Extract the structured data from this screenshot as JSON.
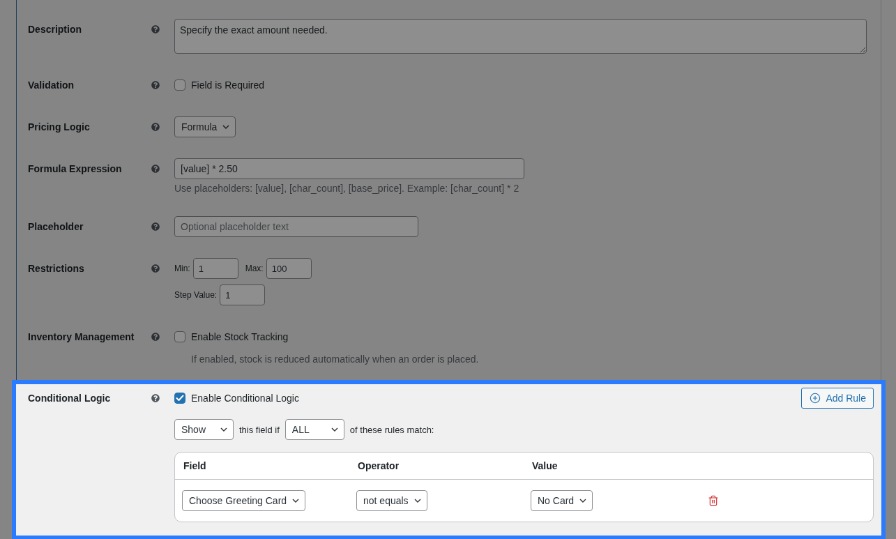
{
  "fields": [
    {
      "kind": "textarea",
      "label": "Description",
      "value": "Specify the exact amount needed.",
      "highlighted": false
    },
    {
      "kind": "checkbox",
      "label": "Validation",
      "option": "Field is Required",
      "checked": false,
      "highlighted": false
    },
    {
      "kind": "select",
      "label": "Pricing Logic",
      "value": "Formula",
      "highlighted": false
    },
    {
      "kind": "formula",
      "label": "Formula Expression",
      "value": "[value] * 2.50",
      "hint": "Use placeholders: [value], [char_count], [base_price]. Example: [char_count] * 2",
      "highlighted": false
    },
    {
      "kind": "text",
      "label": "Placeholder",
      "placeholder": "Optional placeholder text",
      "highlighted": false
    },
    {
      "kind": "restrictions",
      "label": "Restrictions",
      "lines": [
        {
          "inputs": [
            {
              "label": "Min:",
              "value": "1"
            },
            {
              "label": "Max:",
              "value": "100"
            }
          ]
        },
        {
          "inputs": [
            {
              "label": "Step Value:",
              "value": "1"
            }
          ]
        }
      ],
      "highlighted": false
    },
    {
      "kind": "checkbox",
      "label": "Inventory Management",
      "option": "Enable Stock Tracking",
      "checked": false,
      "hint": "If enabled, stock is reduced automatically when an order is placed.",
      "highlighted": false
    },
    {
      "kind": "conditional",
      "label": "Conditional Logic",
      "option": "Enable Conditional Logic",
      "checked": true,
      "highlighted": true,
      "add_button": "Add Rule",
      "action": "Show",
      "connector": "this field if",
      "match": "ALL",
      "suffix": "of these rules match:",
      "rules": {
        "columns": [
          "Field",
          "Operator",
          "Value"
        ],
        "rows": [
          {
            "field": "Choose Greeting Card",
            "operator": "not equals",
            "value": "No Card"
          }
        ]
      }
    }
  ]
}
